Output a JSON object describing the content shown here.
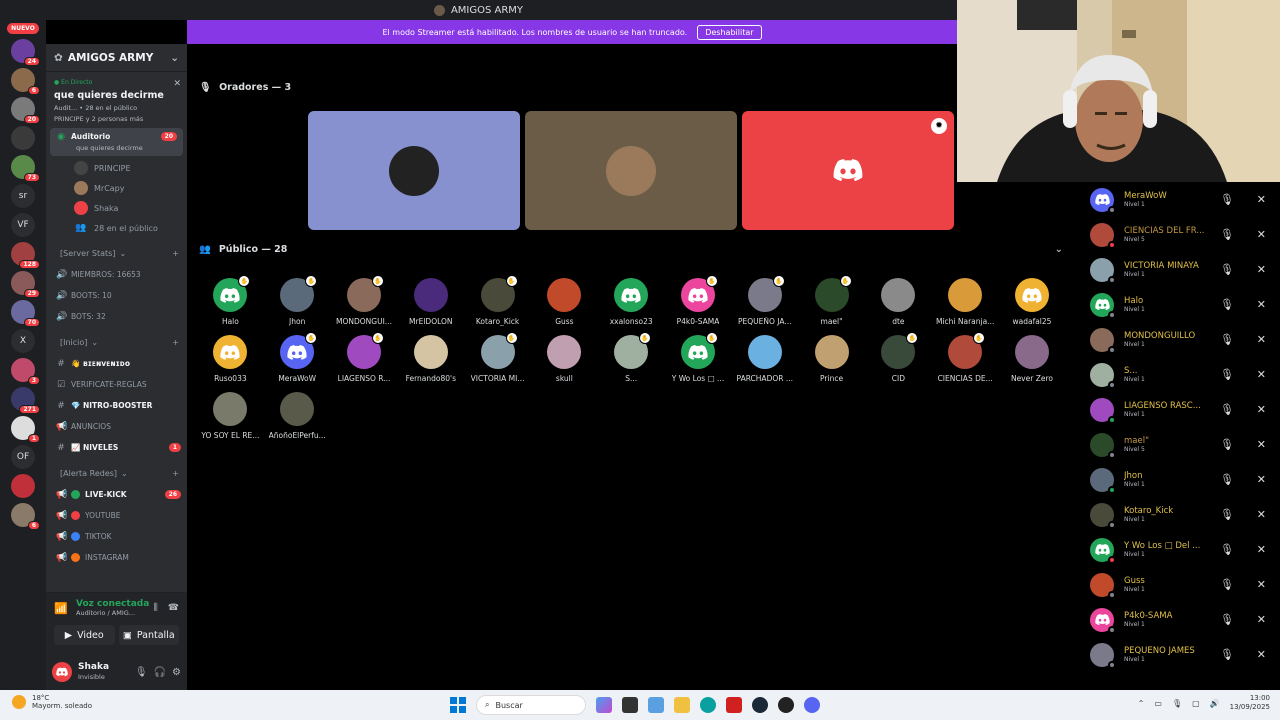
{
  "window": {
    "title": "AMIGOS ARMY"
  },
  "streamer_banner": {
    "text": "El modo Streamer está habilitado. Los nombres de usuario se han truncado.",
    "button": "Deshabilitar"
  },
  "rail": {
    "nuevo": "NUEVO",
    "servers": [
      {
        "color": "#6b3fa0",
        "badge": "24"
      },
      {
        "color": "#8a6a4a",
        "badge": "6"
      },
      {
        "color": "#7a7a7a",
        "badge": "20"
      },
      {
        "color": "#3a3a3a",
        "badge": ""
      },
      {
        "color": "#5a8a4a",
        "badge": "73"
      },
      {
        "color": "#2b2d31",
        "text": "sr",
        "badge": ""
      },
      {
        "color": "#2b2d31",
        "text": "VF",
        "badge": ""
      },
      {
        "color": "#a04040",
        "badge": "128"
      },
      {
        "color": "#8a5a5a",
        "badge": "29"
      },
      {
        "color": "#6a6aa0",
        "badge": "70"
      },
      {
        "color": "#2b2d31",
        "text": "X",
        "badge": ""
      },
      {
        "color": "#c04a6a",
        "badge": "3"
      },
      {
        "color": "#3a3a6a",
        "badge": "271"
      },
      {
        "color": "#ddd",
        "badge": "1"
      },
      {
        "color": "#2b2d31",
        "text": "OF",
        "badge": ""
      },
      {
        "color": "#c0303a",
        "badge": ""
      },
      {
        "color": "#8a7a6a",
        "badge": "6"
      }
    ]
  },
  "sidebar": {
    "server_name": "AMIGOS ARMY",
    "live": {
      "label": "En Directo",
      "topic": "que quieres decirme",
      "line1": "Audit... • 28 en el público",
      "line2": "PRINCIPE y 2 personas más"
    },
    "active_channel": {
      "name": "Auditorio",
      "sub": "que quieres decirme",
      "badge": "20"
    },
    "voice_users": [
      {
        "name": "PRINCIPE",
        "color": "#444"
      },
      {
        "name": "MrCapy",
        "color": "#9a7a5a"
      },
      {
        "name": "Shaka",
        "color": "#ed4245"
      },
      {
        "name": "28 en el público",
        "color": ""
      }
    ],
    "categories": [
      {
        "name": "Server Stats",
        "channels": [
          {
            "icon": "speaker",
            "label": "MIEMBROS: 16653"
          },
          {
            "icon": "speaker",
            "label": "BOOTS: 10"
          },
          {
            "icon": "speaker",
            "label": "BOTS: 32"
          }
        ]
      },
      {
        "name": "Inicio",
        "channels": [
          {
            "icon": "#",
            "label": "👋 ʙɪᴇɴᴠᴇɴɪᴅᴏ",
            "bold": true,
            "badge": ""
          },
          {
            "icon": "☑",
            "label": "VERIFICATE-REGLAS",
            "bold": false,
            "badge": ""
          },
          {
            "icon": "#",
            "label": "💎 NITRO-BOOSTER",
            "bold": true,
            "badge": ""
          },
          {
            "icon": "📢",
            "label": "ANUNCIOS",
            "bold": false,
            "badge": ""
          },
          {
            "icon": "#",
            "label": "📈 NIVELES",
            "bold": true,
            "badge": "1"
          }
        ]
      },
      {
        "name": "Alerta Redes",
        "channels": [
          {
            "icon": "📢",
            "label": "LIVE-KICK",
            "dot": "#23a55a",
            "bold": true,
            "badge": "26"
          },
          {
            "icon": "📢",
            "label": "YOUTUBE",
            "dot": "#f23f43",
            "bold": false,
            "badge": ""
          },
          {
            "icon": "📢",
            "label": "TIKTOK",
            "dot": "#3b82f6",
            "bold": false,
            "badge": ""
          },
          {
            "icon": "📢",
            "label": "INSTAGRAM",
            "dot": "#f97316",
            "bold": false,
            "badge": ""
          }
        ]
      }
    ],
    "voice_panel": {
      "status": "Voz conectada",
      "location": "Auditorio / AMIG...",
      "video_btn": "Video",
      "screen_btn": "Pantalla"
    },
    "user": {
      "name": "Shaka",
      "status": "Invisible"
    }
  },
  "stage": {
    "speakers_header": "Oradores — 3",
    "speakers": [
      {
        "bg": "#8891cf",
        "av": "#222"
      },
      {
        "bg": "#6b5c48",
        "av": "#9a7a5a"
      },
      {
        "bg": "#ed4245",
        "av": "discord"
      }
    ],
    "audience_header": "Público — 28",
    "audience": [
      {
        "name": "Halo",
        "color": "#23a55a",
        "discord": true,
        "hand": true
      },
      {
        "name": "Jhon",
        "color": "#5a6a7a",
        "hand": true
      },
      {
        "name": "MONDONGUI...",
        "color": "#8a6a5a",
        "hand": true
      },
      {
        "name": "MrElDOLON",
        "color": "#4a2a7a",
        "hand": false
      },
      {
        "name": "Kotaro_Kick",
        "color": "#4a4a3a",
        "hand": true
      },
      {
        "name": "Guss",
        "color": "#c04a2a",
        "hand": false
      },
      {
        "name": "xxalonso23",
        "color": "#23a55a",
        "discord": true,
        "hand": false
      },
      {
        "name": "P4k0-SAMA",
        "color": "#eb459e",
        "discord": true,
        "hand": true
      },
      {
        "name": "PEQUEÑO JA...",
        "color": "#7a7a8a",
        "hand": true
      },
      {
        "name": "mael\"",
        "color": "#2a4a2a",
        "hand": true
      },
      {
        "name": "dte",
        "color": "#8a8a8a",
        "hand": false
      },
      {
        "name": "Michi Naranja...",
        "color": "#d99a3a",
        "hand": false
      },
      {
        "name": "wadafal25",
        "color": "#f0b232",
        "discord": true,
        "hand": false
      },
      {
        "name": "Ruso033",
        "color": "#f0b232",
        "discord": true,
        "hand": false
      },
      {
        "name": "MeraWoW",
        "color": "#5865f2",
        "discord": true,
        "hand": true
      },
      {
        "name": "LIAGENSO R...",
        "color": "#a04ac0",
        "hand": true
      },
      {
        "name": "Fernando80's",
        "color": "#d4c4a4",
        "hand": false
      },
      {
        "name": "VICTORIA MI...",
        "color": "#8aa0aa",
        "hand": true
      },
      {
        "name": "skull",
        "color": "#c0a0b0",
        "hand": false
      },
      {
        "name": "S...",
        "color": "#a0b0a0",
        "hand": true
      },
      {
        "name": "Y Wo Los □ ...",
        "color": "#23a55a",
        "discord": true,
        "hand": true
      },
      {
        "name": "PARCHADOR ...",
        "color": "#6ab0e0",
        "hand": false
      },
      {
        "name": "Prince",
        "color": "#c0a070",
        "hand": false
      },
      {
        "name": "CID",
        "color": "#3a4a3a",
        "hand": true
      },
      {
        "name": "CIENCIAS DE...",
        "color": "#b04a3a",
        "hand": true
      },
      {
        "name": "Never Zero",
        "color": "#8a6a8a",
        "hand": false
      },
      {
        "name": "YO SOY EL RE...",
        "color": "#7a7a6a",
        "hand": false
      },
      {
        "name": "AñoñoElPerfu...",
        "color": "#5a5a4a",
        "hand": false
      }
    ]
  },
  "member_list": [
    {
      "name": "MeraWoW",
      "level": "Nivel 1",
      "color": "#5865f2",
      "discord": true,
      "status": "#80848e"
    },
    {
      "name": "CIENCIAS DEL FR...",
      "level": "Nivel 5",
      "color": "#b04a3a",
      "status": "#f23f43",
      "gray": true
    },
    {
      "name": "VICTORIA MINAYA",
      "level": "Nivel 1",
      "color": "#8aa0aa",
      "status": "#80848e"
    },
    {
      "name": "Halo",
      "level": "Nivel 1",
      "color": "#23a55a",
      "discord": true,
      "status": "#80848e"
    },
    {
      "name": "MONDONGUILLO",
      "level": "Nivel 1",
      "color": "#8a6a5a",
      "status": "#80848e"
    },
    {
      "name": "S...",
      "level": "Nivel 1",
      "color": "#a0b0a0",
      "status": "#80848e"
    },
    {
      "name": "LIAGENSO RASC...",
      "level": "Nivel 1",
      "color": "#a04ac0",
      "status": "#23a55a"
    },
    {
      "name": "mael\"",
      "level": "Nivel 5",
      "color": "#2a4a2a",
      "status": "#80848e",
      "gray": true
    },
    {
      "name": "Jhon",
      "level": "Nivel 1",
      "color": "#5a6a7a",
      "status": "#23a55a"
    },
    {
      "name": "Kotaro_Kick",
      "level": "Nivel 1",
      "color": "#4a4a3a",
      "status": "#80848e"
    },
    {
      "name": "Y Wo Los □ Del ...",
      "level": "Nivel 1",
      "color": "#23a55a",
      "discord": true,
      "status": "#f23f43"
    },
    {
      "name": "Guss",
      "level": "Nivel 1",
      "color": "#c04a2a",
      "status": "#80848e"
    },
    {
      "name": "P4k0-SAMA",
      "level": "Nivel 1",
      "color": "#eb459e",
      "discord": true,
      "status": "#80848e"
    },
    {
      "name": "PEQUEÑO JAMES",
      "level": "Nivel 1",
      "color": "#7a7a8a",
      "status": "#80848e"
    }
  ],
  "taskbar": {
    "temp": "18°C",
    "weather": "Mayorm. soleado",
    "search": "Buscar",
    "time": "13:00",
    "date": "13/09/2025"
  }
}
